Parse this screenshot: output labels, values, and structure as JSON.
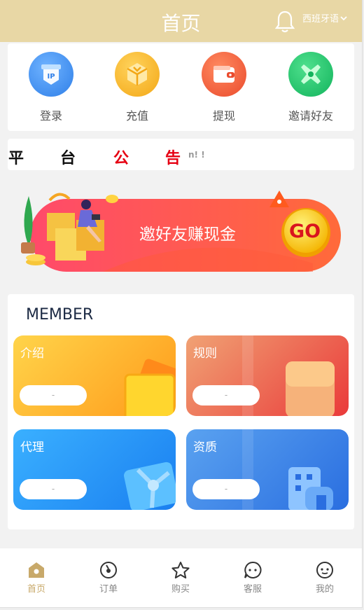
{
  "header": {
    "title": "首页",
    "language": "西班牙语"
  },
  "quick_actions": [
    {
      "label": "登录",
      "icon": "ip-login-icon",
      "color": "#3a8ef0"
    },
    {
      "label": "充值",
      "icon": "cube-recharge-icon",
      "color": "#f5b31a"
    },
    {
      "label": "提现",
      "icon": "wallet-withdraw-icon",
      "color": "#f05a3a"
    },
    {
      "label": "邀请好友",
      "icon": "puzzle-invite-icon",
      "color": "#1dbf6a"
    }
  ],
  "notice": {
    "chars": [
      "平",
      "台",
      "公",
      "告"
    ],
    "scroll_text": "n! !"
  },
  "banner": {
    "text": "邀好友赚现金",
    "go_label": "GO"
  },
  "member": {
    "title": "MEMBER",
    "tiles": [
      {
        "title": "介绍",
        "button": "-"
      },
      {
        "title": "规则",
        "button": "-"
      },
      {
        "title": "代理",
        "button": "-"
      },
      {
        "title": "资质",
        "button": "-"
      }
    ]
  },
  "tabbar": [
    {
      "label": "首页",
      "icon": "home-icon",
      "active": true
    },
    {
      "label": "订单",
      "icon": "order-icon",
      "active": false
    },
    {
      "label": "购买",
      "icon": "star-icon",
      "active": false
    },
    {
      "label": "客服",
      "icon": "chat-icon",
      "active": false
    },
    {
      "label": "我的",
      "icon": "face-icon",
      "active": false
    }
  ],
  "colors": {
    "header": "#e8d7a5",
    "active_tab": "#c8a96a",
    "notice_red": "#e60012"
  }
}
